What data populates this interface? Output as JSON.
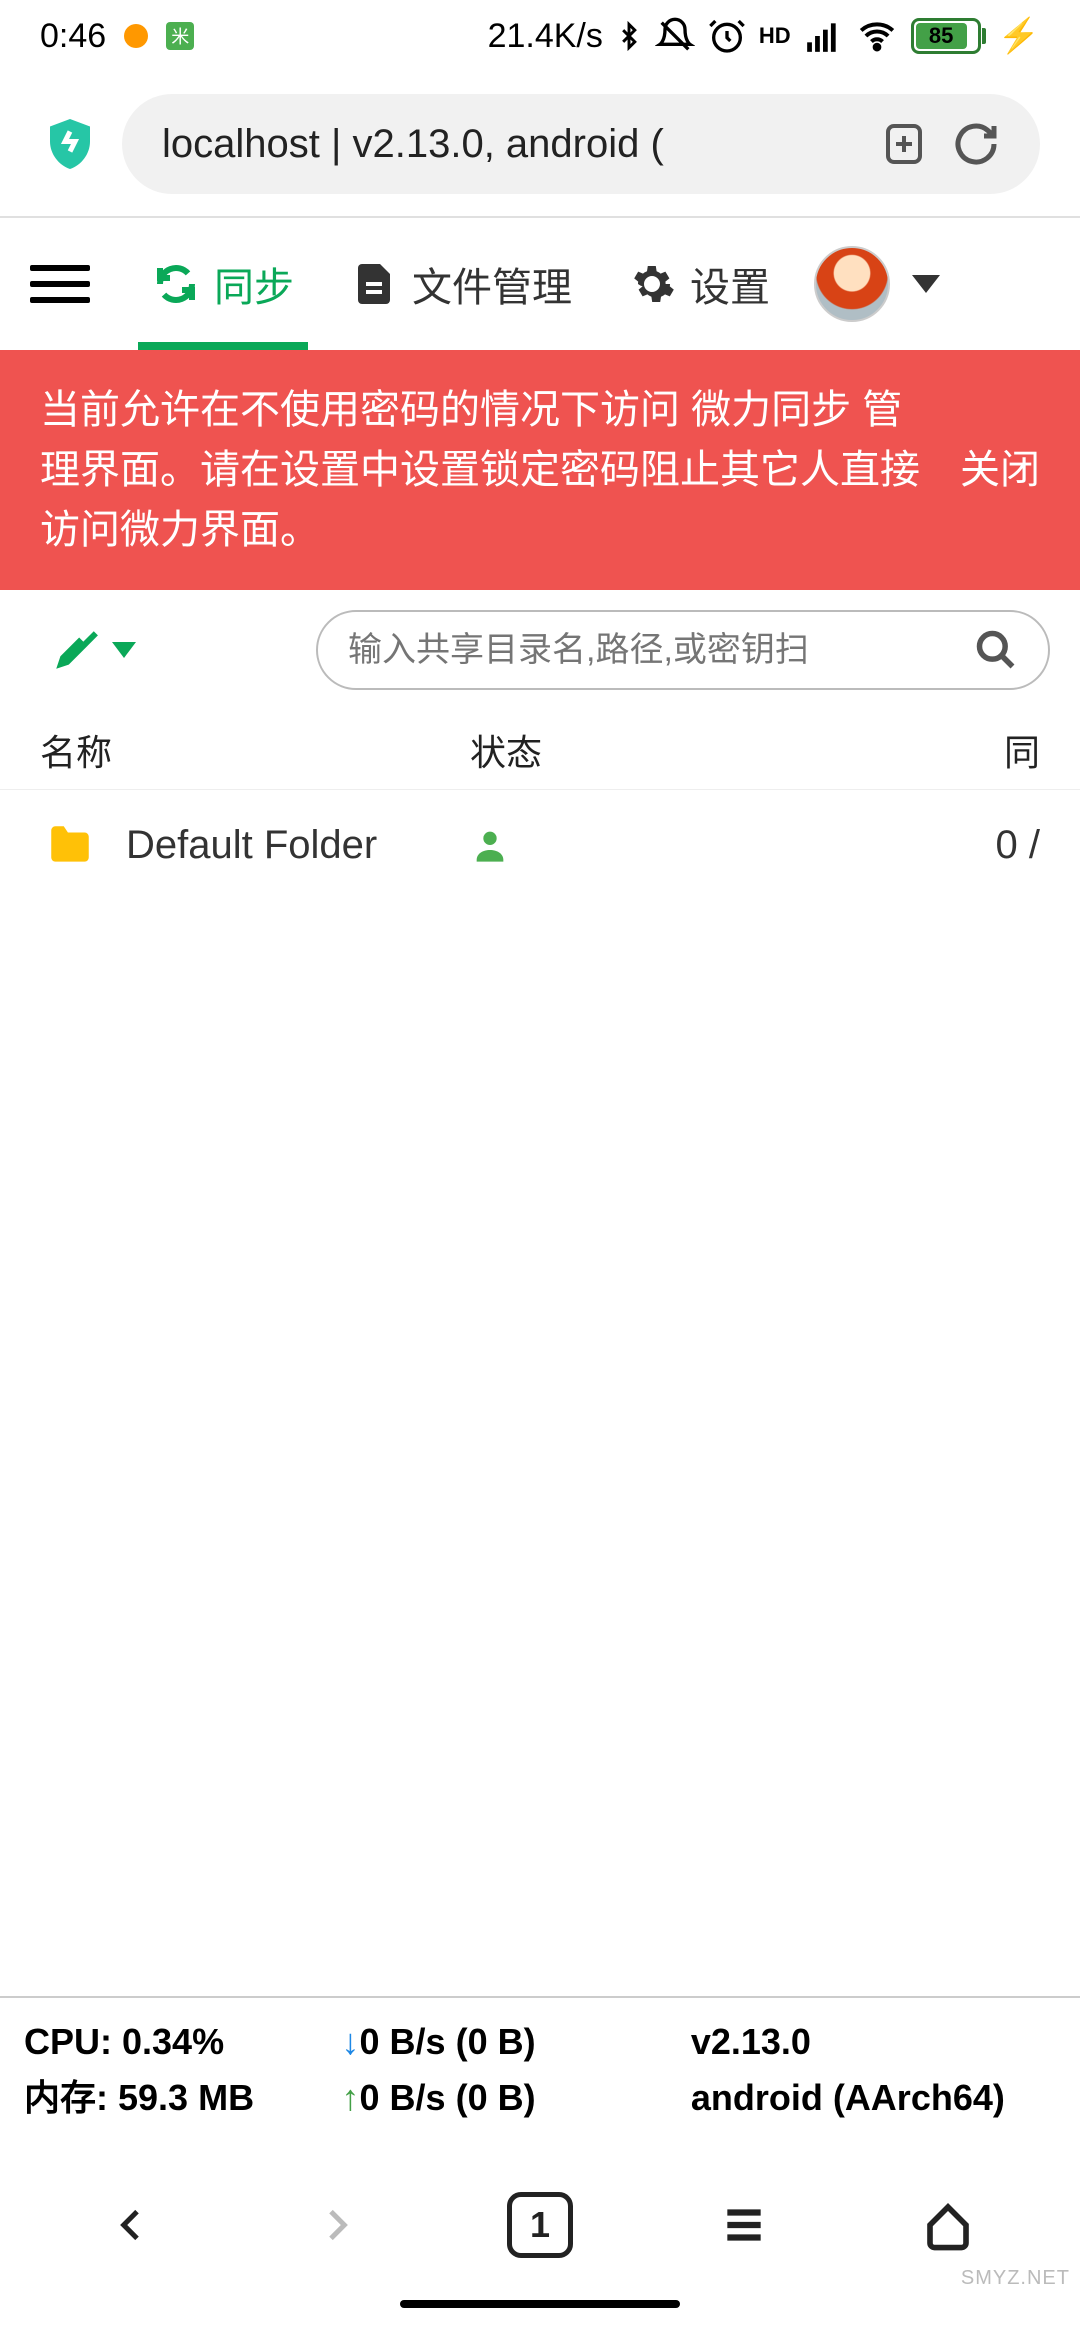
{
  "status": {
    "time": "0:46",
    "net_speed": "21.4K/s",
    "battery_pct": "85"
  },
  "browser": {
    "url_title": "localhost | v2.13.0, android ("
  },
  "tabs": {
    "sync": "同步",
    "files": "文件管理",
    "settings": "设置"
  },
  "banner": {
    "text": "当前允许在不使用密码的情况下访问 微力同步 管理界面。请在设置中设置锁定密码阻止其它人直接访问微力界面。",
    "close": "关闭"
  },
  "search": {
    "placeholder": "输入共享目录名,路径,或密钥扫"
  },
  "thead": {
    "name": "名称",
    "status": "状态",
    "peer": "同"
  },
  "rows": [
    {
      "name": "Default Folder",
      "peer": "0 /"
    }
  ],
  "footer": {
    "cpu_label": "CPU:",
    "cpu_val": "0.34%",
    "mem_label": "内存:",
    "mem_val": "59.3 MB",
    "down": "0 B/s (0 B)",
    "up": "0 B/s (0 B)",
    "version": "v2.13.0",
    "platform": "android (AArch64)"
  },
  "bottom": {
    "tab_count": "1"
  },
  "watermark": "SMYZ.NET"
}
